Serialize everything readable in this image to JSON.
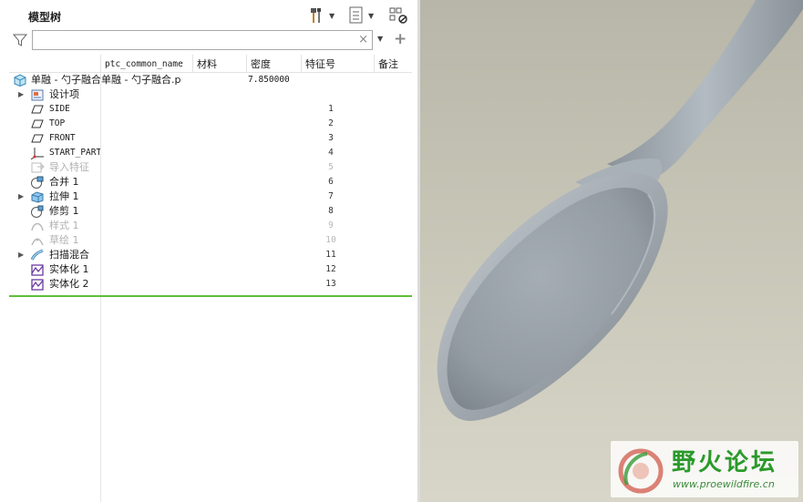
{
  "panel": {
    "title": "模型树"
  },
  "search": {
    "value": "",
    "clear_glyph": "×"
  },
  "columns": [
    "ptc_common_name",
    "材料",
    "密度",
    "特征号",
    "备注"
  ],
  "root": {
    "name": "单融 - 勺子融合",
    "common_name": "单融 - 勺子融合.p",
    "density": "7.850000"
  },
  "rows": [
    {
      "name": "设计项",
      "num": "",
      "icon": "design-items-icon",
      "expandable": true,
      "dim": false,
      "mono": false
    },
    {
      "name": "SIDE",
      "num": "1",
      "icon": "datum-plane-icon",
      "expandable": false,
      "dim": false,
      "mono": true
    },
    {
      "name": "TOP",
      "num": "2",
      "icon": "datum-plane-icon",
      "expandable": false,
      "dim": false,
      "mono": true
    },
    {
      "name": "FRONT",
      "num": "3",
      "icon": "datum-plane-icon",
      "expandable": false,
      "dim": false,
      "mono": true
    },
    {
      "name": "START_PART",
      "num": "4",
      "icon": "coordinate-system-icon",
      "expandable": false,
      "dim": false,
      "mono": true
    },
    {
      "name": "导入特征",
      "num": "5",
      "icon": "import-feature-icon",
      "expandable": false,
      "dim": true,
      "mono": false
    },
    {
      "name": "合并 1",
      "num": "6",
      "icon": "merge-icon",
      "expandable": false,
      "dim": false,
      "mono": false
    },
    {
      "name": "拉伸 1",
      "num": "7",
      "icon": "extrude-icon",
      "expandable": true,
      "dim": false,
      "mono": false
    },
    {
      "name": "修剪 1",
      "num": "8",
      "icon": "trim-icon",
      "expandable": false,
      "dim": false,
      "mono": false
    },
    {
      "name": "样式 1",
      "num": "9",
      "icon": "style-icon",
      "expandable": false,
      "dim": true,
      "mono": false
    },
    {
      "name": "草绘 1",
      "num": "10",
      "icon": "sketch-icon",
      "expandable": false,
      "dim": true,
      "mono": false
    },
    {
      "name": "扫描混合",
      "num": "11",
      "icon": "swept-blend-icon",
      "expandable": true,
      "dim": false,
      "mono": false
    },
    {
      "name": "实体化 1",
      "num": "12",
      "icon": "solidify-icon",
      "expandable": false,
      "dim": false,
      "mono": false
    },
    {
      "name": "实体化 2",
      "num": "13",
      "icon": "solidify-icon",
      "expandable": false,
      "dim": false,
      "mono": false
    }
  ],
  "watermark": {
    "title": "野火论坛",
    "url": "www.proewildfire.cn"
  },
  "colors": {
    "insert_line": "#5fbf3a",
    "watermark_green": "#2a9a2a",
    "spoon": "#9ea6ad"
  }
}
